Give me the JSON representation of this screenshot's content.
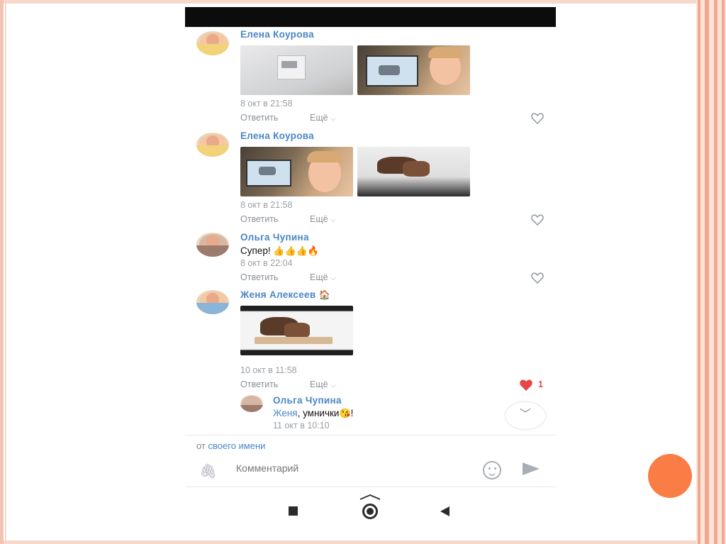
{
  "comments": [
    {
      "author": "Елена Коурова",
      "date": "8 окт в 21:58",
      "reply_label": "Ответить",
      "more_label": "Ещё",
      "photos": [
        "photo-screen",
        "photo-boy-laptop"
      ]
    },
    {
      "author": "Елена Коурова",
      "date": "8 окт в 21:58",
      "reply_label": "Ответить",
      "more_label": "Ещё",
      "photos": [
        "photo-boy-laptop",
        "photo-bread"
      ]
    },
    {
      "author": "Ольга Чупина",
      "text": "Супер!",
      "text_emoji": "👍👍👍🔥",
      "date": "8 окт в 22:04",
      "reply_label": "Ответить",
      "more_label": "Ещё"
    },
    {
      "author": "Женя Алексеев",
      "author_emoji": "🏠",
      "date": "10 окт в 11:58",
      "reply_label": "Ответить",
      "more_label": "Ещё",
      "likes": "1",
      "photos": [
        "photo-bread"
      ]
    }
  ],
  "reply_comment": {
    "author": "Ольга Чупина",
    "mention": "Женя",
    "text": ", умнички",
    "text_emoji": "😘",
    "text_end": "!",
    "date": "11 окт в 10:10"
  },
  "footer": {
    "from_prefix": "от ",
    "from_link": "своего имени",
    "comment_placeholder": "Комментарий"
  },
  "icons": {
    "attach": "paperclip-icon",
    "emoji": "smile-icon",
    "send": "send-icon",
    "scroll_down": "chevron-down-icon",
    "nav_recent": "square-icon",
    "nav_home": "home-circle-icon",
    "nav_back": "back-triangle-icon"
  },
  "colors": {
    "link": "#4a86c5",
    "heart_liked": "#e64646",
    "slide_accent": "#fb7d46"
  }
}
